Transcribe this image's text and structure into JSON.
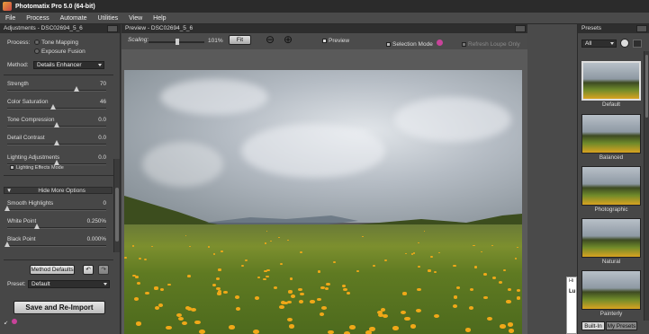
{
  "window": {
    "title": "Photomatix Pro 5.0 (64-bit)"
  },
  "menu": [
    "File",
    "Process",
    "Automate",
    "Utilities",
    "View",
    "Help"
  ],
  "adjustments": {
    "panel_title": "Adjustments - DSC02694_5_6",
    "process_label": "Process:",
    "process_options": [
      "Tone Mapping",
      "Exposure Fusion"
    ],
    "method_label": "Method:",
    "method_value": "Details Enhancer",
    "sliders": [
      {
        "label": "Strength",
        "value": "70",
        "fraction": 0.7
      },
      {
        "label": "Color Saturation",
        "value": "46",
        "fraction": 0.46
      },
      {
        "label": "Tone Compression",
        "value": "0.0",
        "fraction": 0.5
      },
      {
        "label": "Detail Contrast",
        "value": "0.0",
        "fraction": 0.5
      },
      {
        "label": "Lighting Adjustments",
        "value": "0.0",
        "fraction": 0.5
      }
    ],
    "lighting_effects_label": "Lighting Effects Mode",
    "hide_more_label": "Hide More Options",
    "more_sliders": [
      {
        "label": "Smooth Highlights",
        "value": "0",
        "fraction": 0.0
      },
      {
        "label": "White Point",
        "value": "0.250%",
        "fraction": 0.3
      },
      {
        "label": "Black Point",
        "value": "0.000%",
        "fraction": 0.0
      }
    ],
    "method_defaults_label": "Method Defaults",
    "preset_label": "Preset:",
    "preset_value": "Default",
    "save_reimport_label": "Save and Re-Import"
  },
  "preview": {
    "panel_title": "Preview - DSC02694_5_6",
    "scaling_label": "Scaling:",
    "scaling_value": "101%",
    "fit_label": "Fit",
    "selection_mode_label": "Selection Mode",
    "preview_label": "Preview",
    "refresh_label": "Refresh Loupe Only"
  },
  "side_panel": {
    "tab_hint": "Hi",
    "label_hint": "Lu"
  },
  "presets": {
    "panel_title": "Presets",
    "filter_value": "All",
    "items": [
      "Default",
      "Balanced",
      "Photographic",
      "Natural",
      "Painterly"
    ],
    "tabs": [
      "Built-In",
      "My Presets"
    ]
  }
}
